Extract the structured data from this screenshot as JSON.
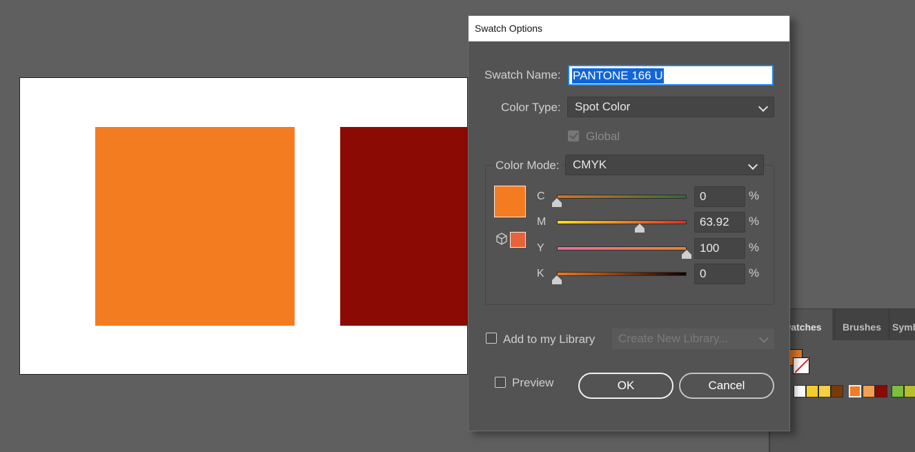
{
  "canvas": {
    "shapes": [
      {
        "name": "orange-rectangle",
        "color": "#f47c20"
      },
      {
        "name": "dark-red-rectangle",
        "color": "#8b0a03"
      }
    ]
  },
  "swatches_panel": {
    "tabs": {
      "swatches": "Swatches",
      "brushes": "Brushes",
      "symbols": "Symbols"
    },
    "swatch_colors": [
      "#f5cc2e",
      "#f5d040",
      "#7a3a08",
      "#f47c20",
      "#f4a050",
      "#8b0a03",
      "#7bbf3a",
      "#b5c02a"
    ]
  },
  "dialog": {
    "title": "Swatch Options",
    "swatch_name_label": "Swatch Name:",
    "swatch_name_value": "PANTONE 166 U",
    "color_type_label": "Color Type:",
    "color_type_value": "Spot Color",
    "global_label": "Global",
    "color_mode_label": "Color Mode:",
    "color_mode_value": "CMYK",
    "preview_color": "#f47c20",
    "gamut_color": "#e8633a",
    "channels": [
      {
        "letter": "C",
        "value": "0",
        "fraction": 0.0,
        "gradient": [
          "#e0701c",
          "#2e6a3a"
        ]
      },
      {
        "letter": "M",
        "value": "63.92",
        "fraction": 0.6392,
        "gradient": [
          "#f5e21a",
          "#e02a28"
        ]
      },
      {
        "letter": "Y",
        "value": "100",
        "fraction": 1.0,
        "gradient": [
          "#ee6aa0",
          "#f08020"
        ]
      },
      {
        "letter": "K",
        "value": "0",
        "fraction": 0.0,
        "gradient": [
          "#f07820",
          "#100000"
        ]
      }
    ],
    "percent_sign": "%",
    "add_library_label": "Add to my Library",
    "library_dropdown": "Create New Library...",
    "preview_label": "Preview",
    "ok_label": "OK",
    "cancel_label": "Cancel"
  }
}
